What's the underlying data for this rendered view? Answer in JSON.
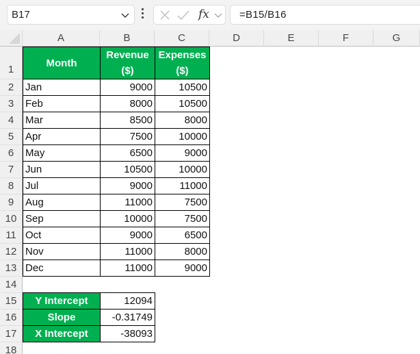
{
  "formula_bar": {
    "name_box": "B17",
    "formula": "=B15/B16",
    "fx_label": "fx",
    "icons": [
      "chevron-down-icon",
      "more-vertical-icon",
      "cancel-icon",
      "enter-check-icon",
      "function-icon"
    ]
  },
  "columns": [
    "A",
    "B",
    "C",
    "D",
    "E",
    "F",
    "G"
  ],
  "rows": [
    "1",
    "2",
    "3",
    "4",
    "5",
    "6",
    "7",
    "8",
    "9",
    "10",
    "11",
    "12",
    "13",
    "14",
    "15",
    "16",
    "17",
    "18"
  ],
  "table": {
    "headers": {
      "month": "Month",
      "revenue_line1": "Revenue",
      "revenue_line2": "($)",
      "expenses_line1": "Expenses",
      "expenses_line2": "($)"
    },
    "rows": [
      {
        "month": "Jan",
        "revenue": "9000",
        "expenses": "10500"
      },
      {
        "month": "Feb",
        "revenue": "8000",
        "expenses": "10500"
      },
      {
        "month": "Mar",
        "revenue": "8500",
        "expenses": "8000"
      },
      {
        "month": "Apr",
        "revenue": "7500",
        "expenses": "10000"
      },
      {
        "month": "May",
        "revenue": "6500",
        "expenses": "9000"
      },
      {
        "month": "Jun",
        "revenue": "10500",
        "expenses": "10000"
      },
      {
        "month": "Jul",
        "revenue": "9000",
        "expenses": "11000"
      },
      {
        "month": "Aug",
        "revenue": "11000",
        "expenses": "7500"
      },
      {
        "month": "Sep",
        "revenue": "10000",
        "expenses": "7500"
      },
      {
        "month": "Oct",
        "revenue": "9000",
        "expenses": "6500"
      },
      {
        "month": "Nov",
        "revenue": "11000",
        "expenses": "8000"
      },
      {
        "month": "Dec",
        "revenue": "11000",
        "expenses": "9000"
      }
    ]
  },
  "results": [
    {
      "label": "Y Intercept",
      "value": "12094"
    },
    {
      "label": "Slope",
      "value": "-0.31749"
    },
    {
      "label": "X Intercept",
      "value": "-38093"
    }
  ],
  "colors": {
    "header_fill": "#00b050",
    "header_text": "#ffffff",
    "grid_background": "#ffffff",
    "chrome_background": "#f3f3f3"
  }
}
